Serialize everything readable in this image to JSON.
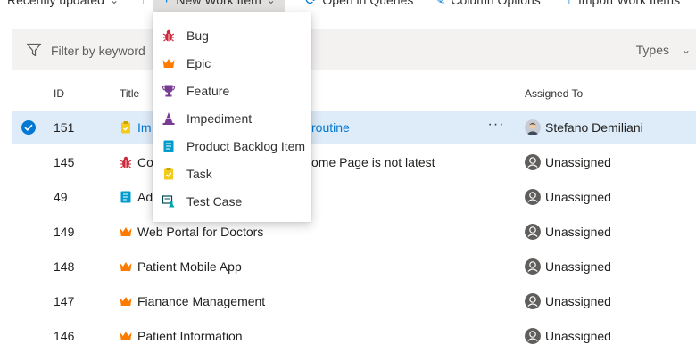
{
  "toolbar": {
    "recently_updated": "Recently updated",
    "new_work_item": "New Work Item",
    "open_in_queries": "Open in Queries",
    "column_options": "Column Options",
    "import_work_items": "Import Work Items"
  },
  "filter": {
    "placeholder": "Filter by keyword",
    "types_label": "Types"
  },
  "columns": {
    "id": "ID",
    "title": "Title",
    "assigned_to": "Assigned To"
  },
  "menu": {
    "items": [
      {
        "label": "Bug",
        "icon": "bug-icon"
      },
      {
        "label": "Epic",
        "icon": "crown-icon"
      },
      {
        "label": "Feature",
        "icon": "trophy-icon"
      },
      {
        "label": "Impediment",
        "icon": "cone-icon"
      },
      {
        "label": "Product Backlog Item",
        "icon": "backlog-item-icon"
      },
      {
        "label": "Task",
        "icon": "clipboard-icon"
      },
      {
        "label": "Test Case",
        "icon": "test-case-icon"
      }
    ]
  },
  "rows": [
    {
      "id": "151",
      "title": "Im",
      "title_tail": "routine",
      "assigned": "Stefano Demiliani",
      "type_icon": "clipboard-icon",
      "selected": true
    },
    {
      "id": "145",
      "title": "Co",
      "title_tail": "ome Page is not latest",
      "assigned": "Unassigned",
      "type_icon": "bug-icon"
    },
    {
      "id": "49",
      "title": "Ad",
      "title_tail": "",
      "assigned": "Unassigned",
      "type_icon": "backlog-item-icon"
    },
    {
      "id": "149",
      "title": "Web Portal for Doctors",
      "assigned": "Unassigned",
      "type_icon": "crown-icon"
    },
    {
      "id": "148",
      "title": "Patient Mobile App",
      "assigned": "Unassigned",
      "type_icon": "crown-icon"
    },
    {
      "id": "147",
      "title": "Fianance Management",
      "assigned": "Unassigned",
      "type_icon": "crown-icon"
    },
    {
      "id": "146",
      "title": "Patient Information",
      "assigned": "Unassigned",
      "type_icon": "crown-icon"
    }
  ],
  "colors": {
    "accent": "#0078d4",
    "bug": "#cc293d",
    "epic": "#ff7b00",
    "feature": "#773b93",
    "task": "#f2cb1d",
    "backlog": "#009ccc",
    "selected_row": "#deecf9"
  }
}
